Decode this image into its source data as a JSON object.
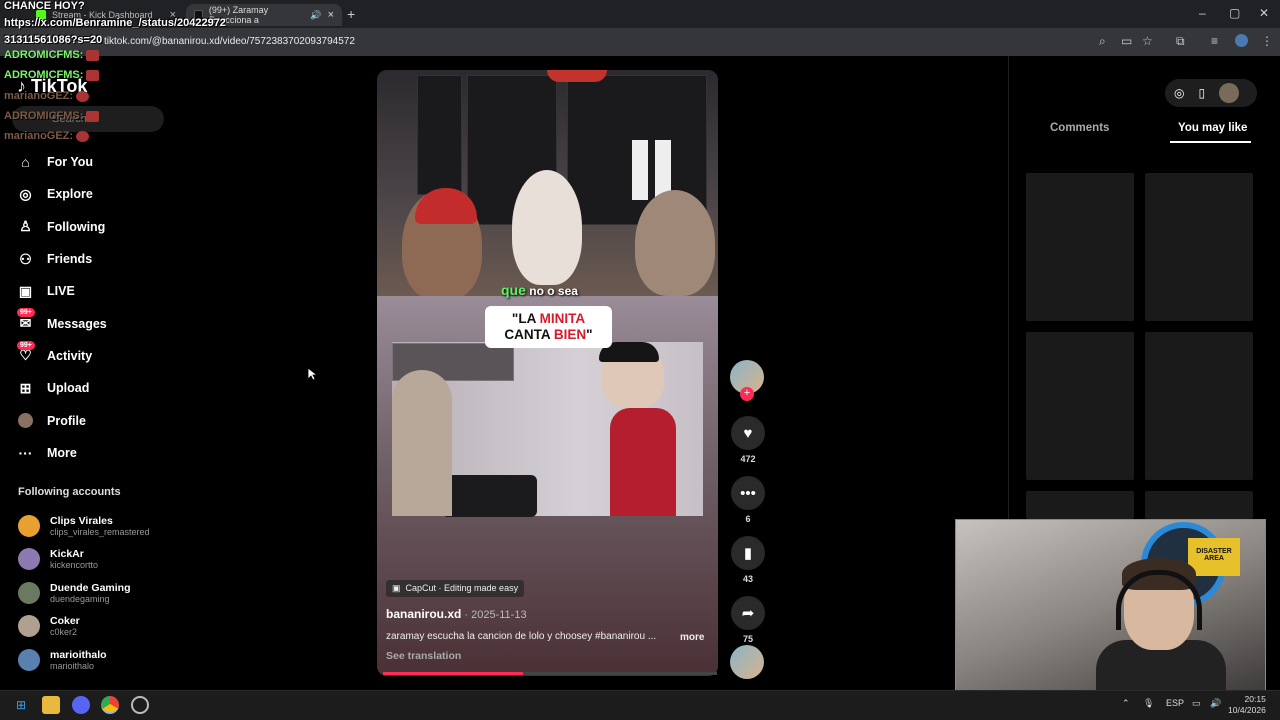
{
  "browser": {
    "tabs": [
      {
        "label": "Stream - Kick Dashboard"
      },
      {
        "label": "(99+) Zaramay Reacciona a"
      }
    ],
    "url": "tiktok.com/@bananirou.xd/video/7572383702093794572"
  },
  "overlay": {
    "line1": "CHANCE HOY?",
    "line2": "https://x.com/Benramine_/status/20422972",
    "line3": "31311561086?s=20",
    "chat": [
      {
        "user": "ADROMICFMS:",
        "color": "green"
      },
      {
        "user": "ADROMICFMS:",
        "color": "green"
      },
      {
        "user": "marianoGEZ:",
        "color": "brown"
      },
      {
        "user": "ADROMICFMS:",
        "color": "brown"
      },
      {
        "user": "marianoGEZ:",
        "color": "brown"
      }
    ]
  },
  "sidebar": {
    "logo": "TikTok",
    "search_placeholder": "Search",
    "nav": [
      {
        "label": "For You",
        "icon": "home-icon"
      },
      {
        "label": "Explore",
        "icon": "compass-icon"
      },
      {
        "label": "Following",
        "icon": "following-icon"
      },
      {
        "label": "Friends",
        "icon": "friends-icon"
      },
      {
        "label": "LIVE",
        "icon": "live-icon"
      },
      {
        "label": "Messages",
        "icon": "messages-icon",
        "badge": "99+"
      },
      {
        "label": "Activity",
        "icon": "activity-icon",
        "badge": "99+"
      },
      {
        "label": "Upload",
        "icon": "upload-icon"
      },
      {
        "label": "Profile",
        "icon": "profile-icon"
      },
      {
        "label": "More",
        "icon": "more-icon"
      }
    ],
    "following_title": "Following accounts",
    "accounts": [
      {
        "name": "Clips Virales",
        "handle": "clips_virales_remastered",
        "color": "#e8a030"
      },
      {
        "name": "KickAr",
        "handle": "kickencortto",
        "color": "#8a7ab0"
      },
      {
        "name": "Duende Gaming",
        "handle": "duendegaming",
        "color": "#6a7a60"
      },
      {
        "name": "Coker",
        "handle": "c0ker2",
        "color": "#b0a090"
      },
      {
        "name": "marioithalo",
        "handle": "marioithalo",
        "color": "#5a80b0"
      }
    ]
  },
  "video": {
    "caption_highlight": "que",
    "caption_rest": "no o sea",
    "bubble_l1a": "\"LA ",
    "bubble_l1b": "MINITA",
    "bubble_l2a": "CANTA ",
    "bubble_l2b": "BIEN",
    "bubble_l2c": "\"",
    "capcut": "CapCut · Editing made easy",
    "author": "bananirou.xd",
    "date": " · 2025-11-13",
    "description": "zaramay escucha la cancion de lolo y choosey #bananirou ...",
    "more": "more",
    "see_translation": "See translation",
    "progress": 0.42
  },
  "actions": {
    "likes": "472",
    "comments": "6",
    "saves": "43",
    "shares": "75"
  },
  "right": {
    "tab_comments": "Comments",
    "tab_you_may_like": "You may like"
  },
  "cam": {
    "sign": "DISASTER AREA"
  },
  "taskbar": {
    "lang": "ESP",
    "time": "20:15",
    "date": "10/4/2026"
  }
}
